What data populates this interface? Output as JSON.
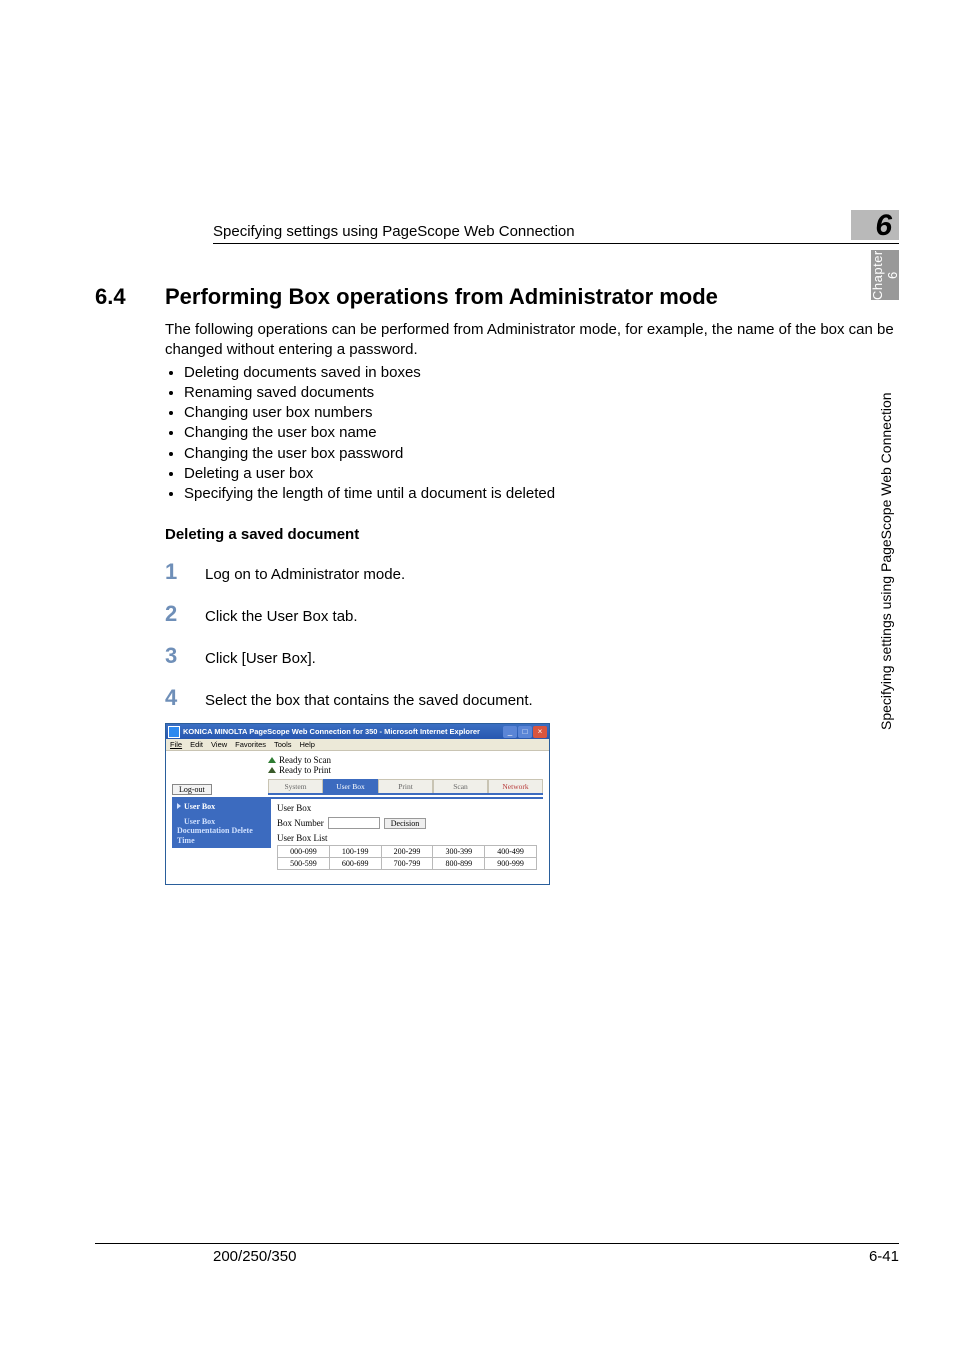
{
  "header": {
    "running_title": "Specifying settings using PageScope Web Connection",
    "chapter_number": "6"
  },
  "sidetab": {
    "label": "Chapter 6",
    "vertical": "Specifying settings using PageScope Web Connection"
  },
  "section": {
    "number": "6.4",
    "title": "Performing Box operations from Administrator mode",
    "intro": "The following operations can be performed from Administrator mode, for example, the name of the box can be changed without entering a password.",
    "bullets": [
      "Deleting documents saved in boxes",
      "Renaming saved documents",
      "Changing user box numbers",
      "Changing the user box name",
      "Changing the user box password",
      "Deleting a user box",
      "Specifying the length of time until a document is deleted"
    ],
    "subhead": "Deleting a saved document"
  },
  "steps": [
    {
      "n": "1",
      "text": "Log on to Administrator mode."
    },
    {
      "n": "2",
      "text": "Click the User Box tab."
    },
    {
      "n": "3",
      "text": "Click [User Box]."
    },
    {
      "n": "4",
      "text": "Select the box that contains the saved document."
    }
  ],
  "screenshot": {
    "window_title": "KONICA MINOLTA PageScope Web Connection for 350 - Microsoft Internet Explorer",
    "menubar": [
      "File",
      "Edit",
      "View",
      "Favorites",
      "Tools",
      "Help"
    ],
    "status": {
      "line1": "Ready to Scan",
      "line2": "Ready to Print"
    },
    "logout": "Log-out",
    "tabs": [
      "System",
      "User Box",
      "Print",
      "Scan",
      "Network"
    ],
    "side_nav": {
      "item1": "User Box",
      "item2": "User Box Documentation Delete Time"
    },
    "main": {
      "title": "User Box",
      "box_number_label": "Box Number",
      "decision": "Decision",
      "list_label": "User Box List",
      "ranges_row1": [
        "000-099",
        "100-199",
        "200-299",
        "300-399",
        "400-499"
      ],
      "ranges_row2": [
        "500-599",
        "600-699",
        "700-799",
        "800-899",
        "900-999"
      ]
    }
  },
  "footer": {
    "left": "200/250/350",
    "right": "6-41"
  }
}
